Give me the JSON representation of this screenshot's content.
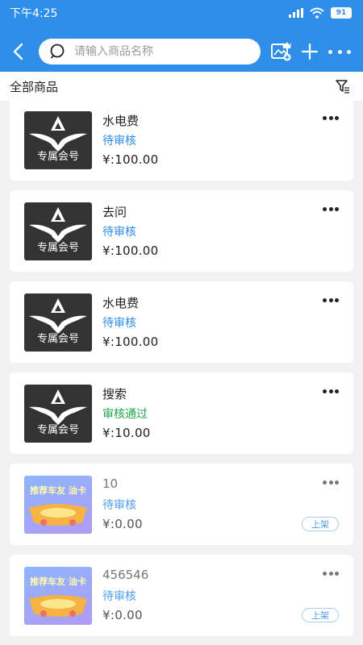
{
  "status_bar": {
    "time": "下午4:25",
    "battery": "91"
  },
  "toolbar": {
    "search_placeholder": "请输入商品名称"
  },
  "subheader": {
    "title": "全部商品"
  },
  "products": [
    {
      "name": "水电费",
      "status": "待审核",
      "status_type": "pending",
      "price": "¥:100.00",
      "thumb_type": "vip",
      "thumb_text": "专属会号",
      "shelf_label": ""
    },
    {
      "name": "去问",
      "status": "待审核",
      "status_type": "pending",
      "price": "¥:100.00",
      "thumb_type": "vip",
      "thumb_text": "专属会号",
      "shelf_label": ""
    },
    {
      "name": "水电费",
      "status": "待审核",
      "status_type": "pending",
      "price": "¥:100.00",
      "thumb_type": "vip",
      "thumb_text": "专属会号",
      "shelf_label": ""
    },
    {
      "name": "搜索",
      "status": "审核通过",
      "status_type": "approved",
      "price": "¥:10.00",
      "thumb_type": "vip",
      "thumb_text": "专属会号",
      "shelf_label": ""
    },
    {
      "name": "10",
      "status": "待审核",
      "status_type": "pending",
      "price": "¥:0.00",
      "thumb_type": "promo",
      "thumb_text": "推荐车友 油卡",
      "shelf_label": "上架"
    },
    {
      "name": "456546",
      "status": "待审核",
      "status_type": "pending",
      "price": "¥:0.00",
      "thumb_type": "promo",
      "thumb_text": "推荐车友 油卡",
      "shelf_label": "上架"
    }
  ],
  "colors": {
    "header_blue": "#2f8ee8",
    "pending": "#2f8ee8",
    "approved": "#1fa64a"
  }
}
